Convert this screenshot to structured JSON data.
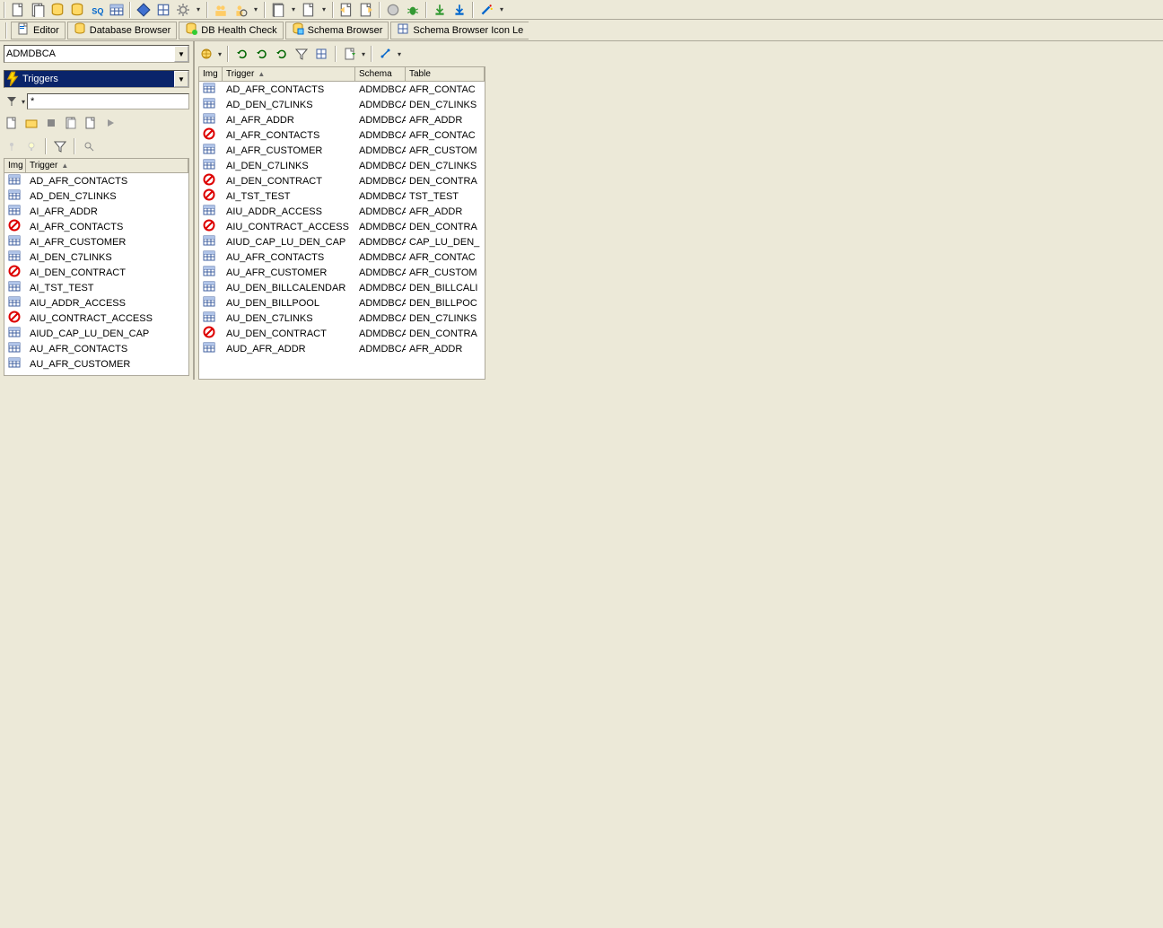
{
  "topToolbar": {
    "groups": [
      [
        "doc-multi",
        "doc-db",
        "db-mag",
        "db-link",
        "sql",
        "db-table"
      ],
      [
        "diamond-blue",
        "grid",
        "gear"
      ],
      [
        "people",
        "person-mag"
      ],
      [
        "doc-stack"
      ],
      [
        "doc-arrow-l",
        "doc-arrow-r"
      ],
      [
        "stop",
        "bug"
      ],
      [
        "arrow-down-green",
        "arrow-down-blue"
      ],
      [
        "wand"
      ]
    ]
  },
  "tabs": [
    {
      "icon": "doc-blue",
      "label": "Editor"
    },
    {
      "icon": "db-yellow",
      "label": "Database Browser"
    },
    {
      "icon": "db-green",
      "label": "DB Health Check"
    },
    {
      "icon": "db-cyan",
      "label": "Schema Browser"
    },
    {
      "icon": "grid-blue",
      "label": "Schema Browser Icon Le"
    }
  ],
  "schemaCombo": {
    "value": "ADMDBCA"
  },
  "objectTypeCombo": {
    "value": "Triggers"
  },
  "filter": {
    "value": "*"
  },
  "leftGrid": {
    "columns": [
      "Img",
      "Trigger"
    ],
    "rows": [
      {
        "icon": "table",
        "name": "AD_AFR_CONTACTS"
      },
      {
        "icon": "table",
        "name": "AD_DEN_C7LINKS"
      },
      {
        "icon": "table",
        "name": "AI_AFR_ADDR"
      },
      {
        "icon": "disabled",
        "name": "AI_AFR_CONTACTS"
      },
      {
        "icon": "table",
        "name": "AI_AFR_CUSTOMER"
      },
      {
        "icon": "table",
        "name": "AI_DEN_C7LINKS"
      },
      {
        "icon": "disabled",
        "name": "AI_DEN_CONTRACT"
      },
      {
        "icon": "table",
        "name": "AI_TST_TEST"
      },
      {
        "icon": "table",
        "name": "AIU_ADDR_ACCESS"
      },
      {
        "icon": "disabled",
        "name": "AIU_CONTRACT_ACCESS"
      },
      {
        "icon": "table",
        "name": "AIUD_CAP_LU_DEN_CAP"
      },
      {
        "icon": "table",
        "name": "AU_AFR_CONTACTS"
      },
      {
        "icon": "table",
        "name": "AU_AFR_CUSTOMER"
      }
    ]
  },
  "rightGrid": {
    "columns": [
      "Img",
      "Trigger",
      "Schema",
      "Table"
    ],
    "rows": [
      {
        "icon": "table",
        "name": "AD_AFR_CONTACTS",
        "schema": "ADMDBCA",
        "table": "AFR_CONTAC"
      },
      {
        "icon": "table",
        "name": "AD_DEN_C7LINKS",
        "schema": "ADMDBCA",
        "table": "DEN_C7LINKS"
      },
      {
        "icon": "table",
        "name": "AI_AFR_ADDR",
        "schema": "ADMDBCA",
        "table": "AFR_ADDR"
      },
      {
        "icon": "disabled",
        "name": "AI_AFR_CONTACTS",
        "schema": "ADMDBCA",
        "table": "AFR_CONTAC"
      },
      {
        "icon": "table",
        "name": "AI_AFR_CUSTOMER",
        "schema": "ADMDBCA",
        "table": "AFR_CUSTOM"
      },
      {
        "icon": "table",
        "name": "AI_DEN_C7LINKS",
        "schema": "ADMDBCA",
        "table": "DEN_C7LINKS"
      },
      {
        "icon": "disabled",
        "name": "AI_DEN_CONTRACT",
        "schema": "ADMDBCA",
        "table": "DEN_CONTRA"
      },
      {
        "icon": "disabled",
        "name": "AI_TST_TEST",
        "schema": "ADMDBCA",
        "table": "TST_TEST"
      },
      {
        "icon": "table",
        "name": "AIU_ADDR_ACCESS",
        "schema": "ADMDBCA",
        "table": "AFR_ADDR"
      },
      {
        "icon": "disabled",
        "name": "AIU_CONTRACT_ACCESS",
        "schema": "ADMDBCA",
        "table": "DEN_CONTRA"
      },
      {
        "icon": "table",
        "name": "AIUD_CAP_LU_DEN_CAP",
        "schema": "ADMDBCA",
        "table": "CAP_LU_DEN_"
      },
      {
        "icon": "table",
        "name": "AU_AFR_CONTACTS",
        "schema": "ADMDBCA",
        "table": "AFR_CONTAC"
      },
      {
        "icon": "table",
        "name": "AU_AFR_CUSTOMER",
        "schema": "ADMDBCA",
        "table": "AFR_CUSTOM"
      },
      {
        "icon": "table",
        "name": "AU_DEN_BILLCALENDAR",
        "schema": "ADMDBCA",
        "table": "DEN_BILLCALI"
      },
      {
        "icon": "table",
        "name": "AU_DEN_BILLPOOL",
        "schema": "ADMDBCA",
        "table": "DEN_BILLPOC"
      },
      {
        "icon": "table",
        "name": "AU_DEN_C7LINKS",
        "schema": "ADMDBCA",
        "table": "DEN_C7LINKS"
      },
      {
        "icon": "disabled",
        "name": "AU_DEN_CONTRACT",
        "schema": "ADMDBCA",
        "table": "DEN_CONTRA"
      },
      {
        "icon": "table",
        "name": "AUD_AFR_ADDR",
        "schema": "ADMDBCA",
        "table": "AFR_ADDR"
      }
    ]
  }
}
